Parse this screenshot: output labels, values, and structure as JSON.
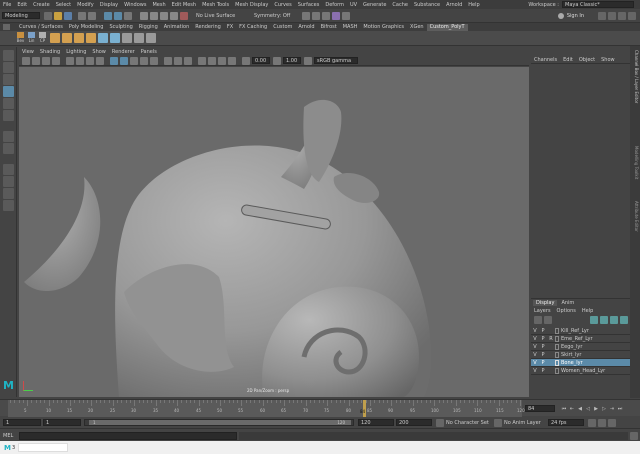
{
  "menubar": {
    "items": [
      "File",
      "Edit",
      "Create",
      "Select",
      "Modify",
      "Display",
      "Windows",
      "Mesh",
      "Edit Mesh",
      "Mesh Tools",
      "Mesh Display",
      "Curves",
      "Surfaces",
      "Deform",
      "UV",
      "Generate",
      "Cache",
      "Substance",
      "Arnold",
      "Help"
    ],
    "workspace_label": "Workspace :",
    "workspace_value": "Maya Classic*"
  },
  "statusline": {
    "mode": "Modeling",
    "live_surface": "No Live Surface",
    "symmetry": "Symmetry: Off",
    "sign_in": "Sign In"
  },
  "shelf": {
    "tabs": [
      "Curves / Surfaces",
      "Poly Modeling",
      "Sculpting",
      "Rigging",
      "Animation",
      "Rendering",
      "FX",
      "FX Caching",
      "Custom",
      "Arnold",
      "Bifrost",
      "MASH",
      "Motion Graphics",
      "XGen",
      "Custom_PolyT"
    ],
    "active_tab": "Custom_PolyT",
    "button_labels": [
      "Bev",
      "Lin",
      "CP"
    ]
  },
  "viewport": {
    "menus": [
      "View",
      "Shading",
      "Lighting",
      "Show",
      "Renderer",
      "Panels"
    ],
    "field_a": "0.00",
    "field_b": "1.00",
    "color_space": "sRGB gamma",
    "camera_label": "2D Pan/Zoom : persp"
  },
  "channelbox": {
    "menus": [
      "Channels",
      "Edit",
      "Object",
      "Show"
    ]
  },
  "side_tabs": [
    "Channel Box / Layer Editor",
    "Modelling Toolkit",
    "Attribute Editor"
  ],
  "layer_editor": {
    "tabs": [
      "Display",
      "Anim"
    ],
    "menus": [
      "Layers",
      "Options",
      "Help"
    ],
    "layers": [
      {
        "v": "V",
        "p": "P",
        "r": "",
        "name": "Kill_Ref_Lyr",
        "selected": false
      },
      {
        "v": "V",
        "p": "P",
        "r": "R",
        "name": "Eme_Ref_Lyr",
        "selected": false
      },
      {
        "v": "V",
        "p": "P",
        "r": "",
        "name": "Eego_lyr",
        "selected": false
      },
      {
        "v": "V",
        "p": "P",
        "r": "",
        "name": "Skirt_lyr",
        "selected": false
      },
      {
        "v": "V",
        "p": "P",
        "r": "",
        "name": "Bone_lyr",
        "selected": true
      },
      {
        "v": "V",
        "p": "P",
        "r": "",
        "name": "Women_Head_Lyr",
        "selected": false
      }
    ]
  },
  "timeline": {
    "tick_labels": [
      "5",
      "10",
      "15",
      "20",
      "25",
      "30",
      "35",
      "40",
      "45",
      "50",
      "55",
      "60",
      "65",
      "70",
      "75",
      "80",
      "85",
      "90",
      "95",
      "100",
      "105",
      "110",
      "115",
      "120"
    ],
    "current_frame_marker": "84",
    "current_frame_field": "84"
  },
  "range_slider": {
    "start": "1",
    "playback_start": "1",
    "range_start": "1",
    "range_end": "120",
    "playback_end": "120",
    "end": "200",
    "character_set": "No Character Set",
    "anim_layer": "No Anim Layer",
    "fps": "24 fps"
  },
  "command_line": {
    "label": "MEL"
  },
  "taskbar": {
    "app_label": "M",
    "app_suffix": "3"
  },
  "colors": {
    "accent_blue": "#5b8aa8",
    "playhead": "#d8b04a",
    "viewport_bg": "#6a6a6a",
    "ui_dark": "#444444"
  }
}
